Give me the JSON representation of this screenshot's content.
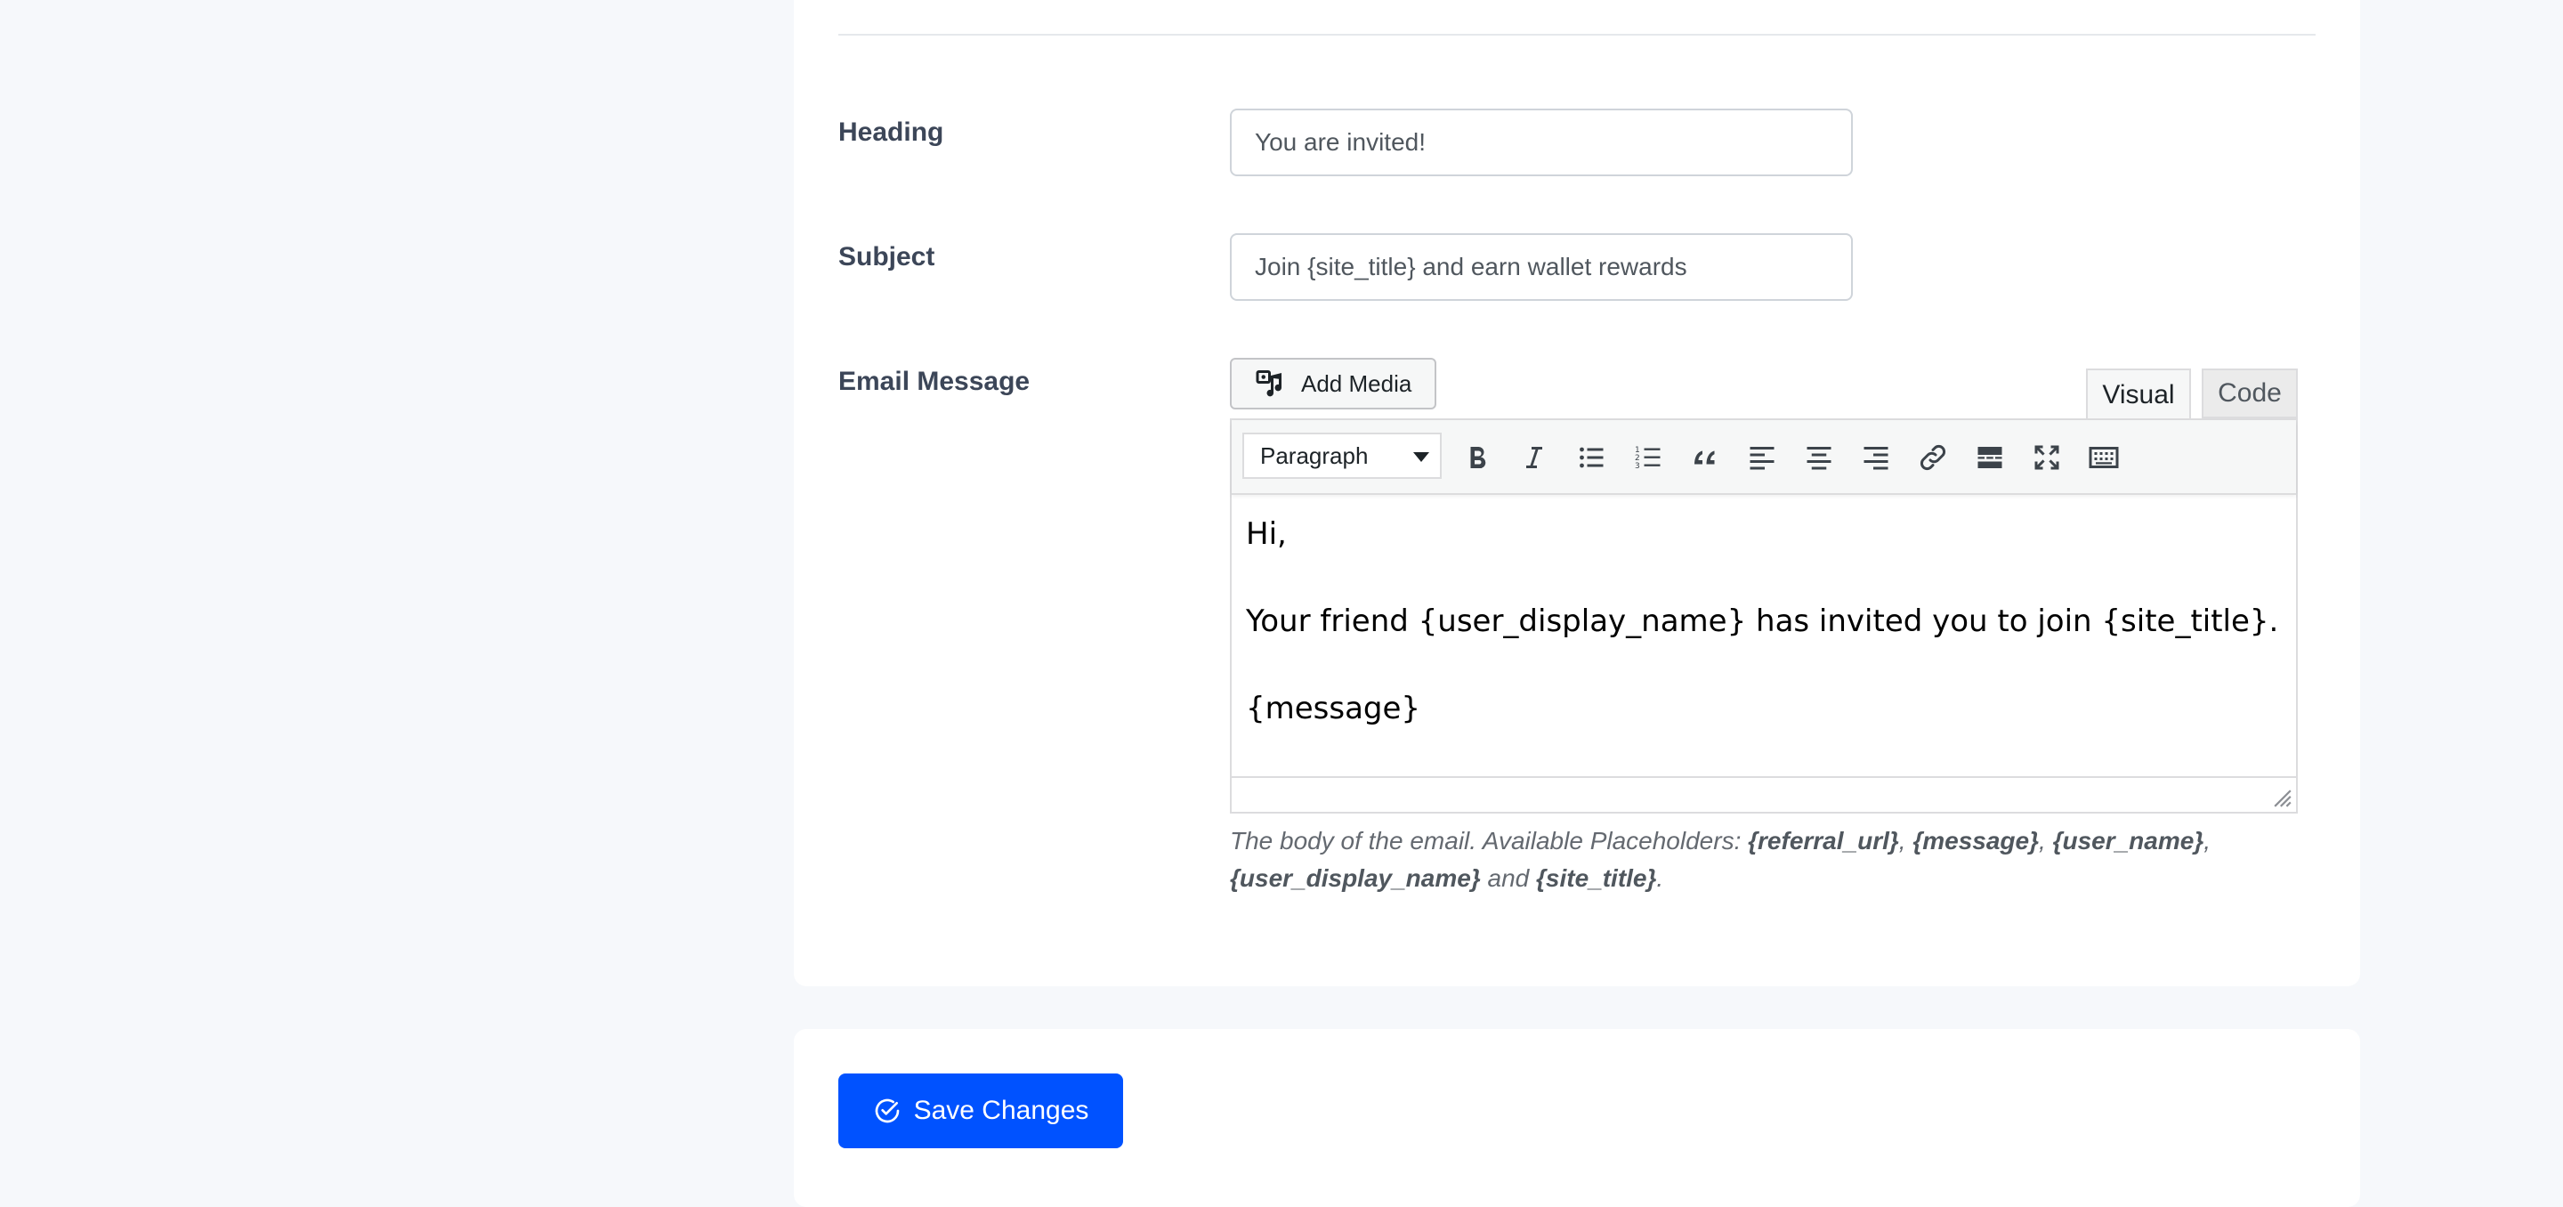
{
  "form": {
    "heading": {
      "label": "Heading",
      "value": "You are invited!"
    },
    "subject": {
      "label": "Subject",
      "value": "Join {site_title} and earn wallet rewards"
    },
    "email_message": {
      "label": "Email Message"
    }
  },
  "editor": {
    "add_media_label": "Add Media",
    "tabs": {
      "visual": "Visual",
      "code": "Code"
    },
    "format_select": "Paragraph",
    "toolbar_icons": [
      "bold-icon",
      "italic-icon",
      "bullet-list-icon",
      "numbered-list-icon",
      "blockquote-icon",
      "align-left-icon",
      "align-center-icon",
      "align-right-icon",
      "link-icon",
      "read-more-icon",
      "fullscreen-icon",
      "toolbar-toggle-icon"
    ],
    "content": {
      "line1": "Hi,",
      "line2": "Your friend {user_display_name} has invited you to join {site_title}.",
      "line3": "{message}"
    },
    "help": {
      "prefix": "The body of the email. Available Placeholders: ",
      "ph1": "{referral_url}",
      "sep1": ", ",
      "ph2": "{message}",
      "sep2": ", ",
      "ph3": "{user_name}",
      "sep3": ",",
      "ph4": "{user_display_name}",
      "and": " and ",
      "ph5": "{site_title}",
      "end": "."
    }
  },
  "actions": {
    "save_label": "Save Changes"
  },
  "colors": {
    "primary": "#0052ff",
    "background": "#f6f8fb",
    "label": "#3c4658"
  }
}
